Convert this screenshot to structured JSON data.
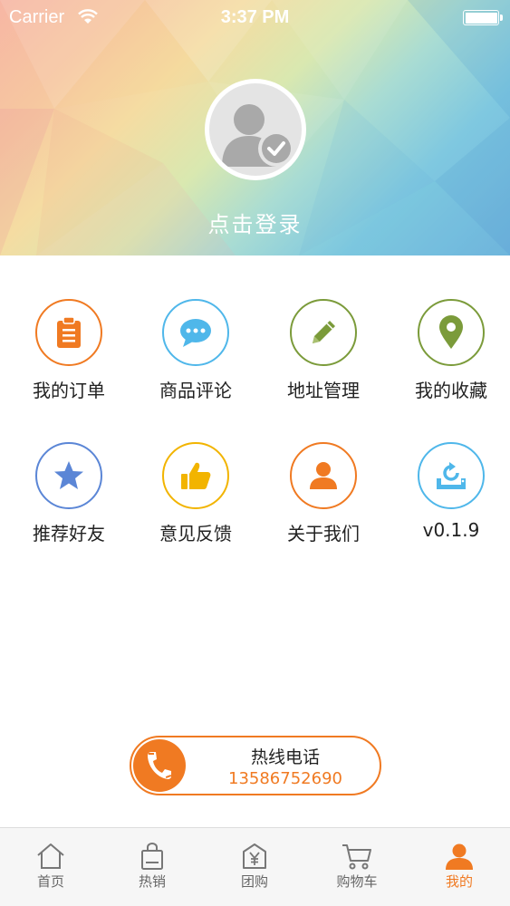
{
  "status_bar": {
    "carrier": "Carrier",
    "time": "3:37 PM"
  },
  "header": {
    "login_text": "点击登录"
  },
  "menu": [
    {
      "label": "我的订单",
      "icon": "clipboard-icon",
      "color": "#f07a22"
    },
    {
      "label": "商品评论",
      "icon": "chat-bubble-icon",
      "color": "#4fb7ea"
    },
    {
      "label": "地址管理",
      "icon": "pencil-icon",
      "color": "#7b9b3a"
    },
    {
      "label": "我的收藏",
      "icon": "location-pin-icon",
      "color": "#7b9b3a"
    },
    {
      "label": "推荐好友",
      "icon": "star-icon",
      "color": "#5b86d6"
    },
    {
      "label": "意见反馈",
      "icon": "thumbs-up-icon",
      "color": "#f2b400"
    },
    {
      "label": "关于我们",
      "icon": "person-icon",
      "color": "#f07a22"
    },
    {
      "label": "v0.1.9",
      "icon": "update-icon",
      "color": "#4fb7ea"
    }
  ],
  "hotline": {
    "title": "热线电话",
    "number": "13586752690",
    "accent": "#f07a22"
  },
  "tabs": [
    {
      "label": "首页",
      "icon": "home-icon",
      "active": false
    },
    {
      "label": "热销",
      "icon": "shopping-bag-icon",
      "active": false
    },
    {
      "label": "团购",
      "icon": "yen-bag-icon",
      "active": false
    },
    {
      "label": "购物车",
      "icon": "cart-icon",
      "active": false
    },
    {
      "label": "我的",
      "icon": "user-icon",
      "active": true
    }
  ]
}
